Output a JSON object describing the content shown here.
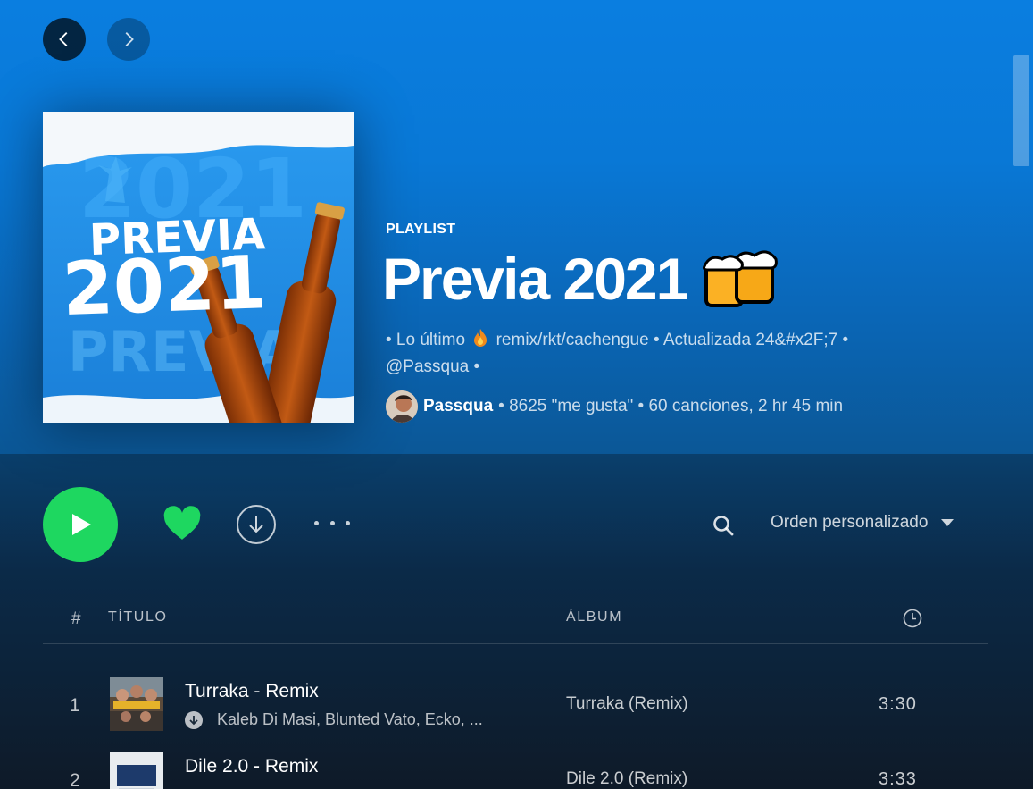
{
  "nav": {
    "back_icon": "chevron-left-icon",
    "forward_icon": "chevron-right-icon"
  },
  "cover": {
    "text_line1": "PREVIA",
    "text_line2": "2021",
    "bg_text1": "2021",
    "bg_text2": "PREVIA"
  },
  "playlist": {
    "type_label": "PLAYLIST",
    "title": "Previa 2021",
    "title_emoji": "beer-mugs-emoji",
    "description_part1": "• Lo último",
    "description_part2": "remix/rkt/cachengue • Actualizada 24&#x2F;7 •",
    "description_line2": "@Passqua •",
    "owner": "Passqua",
    "stats": "• 8625 \"me gusta\" • 60 canciones, 2 hr 45 min"
  },
  "actions": {
    "sort_label": "Orden personalizado"
  },
  "table": {
    "headers": {
      "num": "#",
      "title": "TÍTULO",
      "album": "ÁLBUM"
    },
    "rows": [
      {
        "num": "1",
        "name": "Turraka - Remix",
        "artists": "Kaleb Di Masi, Blunted Vato, Ecko, ...",
        "album": "Turraka (Remix)",
        "duration": "3:30"
      },
      {
        "num": "2",
        "name": "Dile 2.0 - Remix",
        "artists": "",
        "album": "Dile 2.0 (Remix)",
        "duration": "3:33"
      }
    ]
  },
  "colors": {
    "accent_green": "#1ed760",
    "header_blue": "#0a7ee0"
  }
}
